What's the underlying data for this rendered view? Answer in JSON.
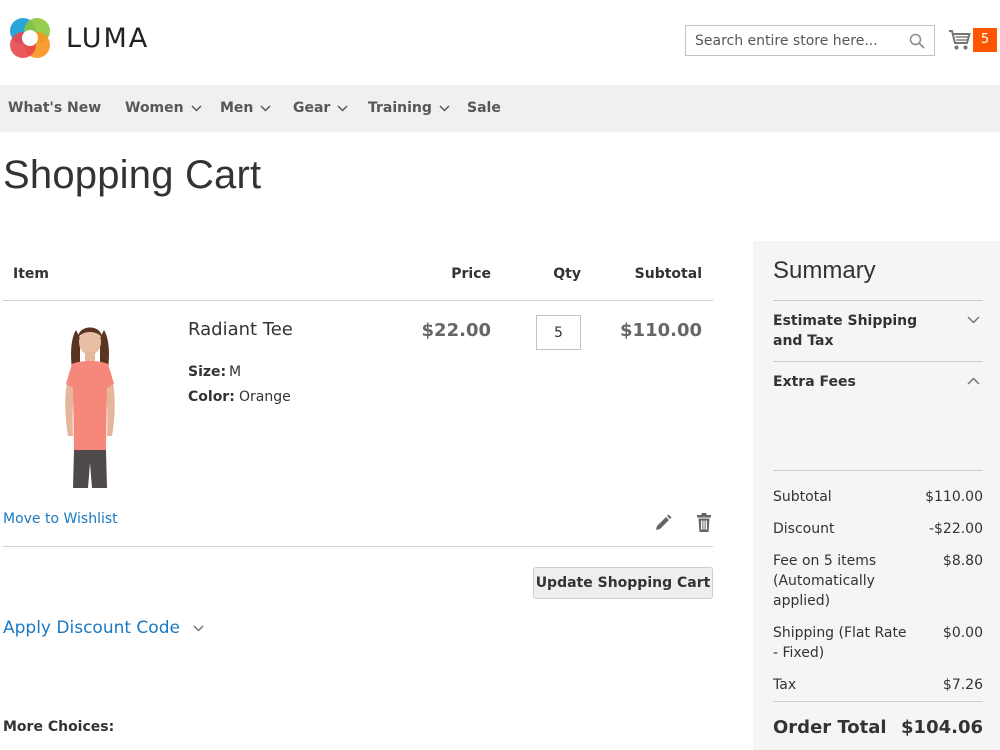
{
  "header": {
    "logo_text": "LUMA",
    "search_placeholder": "Search entire store here...",
    "cart_count": "5",
    "accent_color": "#ff5501"
  },
  "nav": {
    "items": [
      {
        "label": "What's New",
        "has_dropdown": false
      },
      {
        "label": "Women",
        "has_dropdown": true
      },
      {
        "label": "Men",
        "has_dropdown": true
      },
      {
        "label": "Gear",
        "has_dropdown": true
      },
      {
        "label": "Training",
        "has_dropdown": true
      },
      {
        "label": "Sale",
        "has_dropdown": false
      }
    ]
  },
  "page": {
    "title": "Shopping Cart"
  },
  "cart": {
    "columns": {
      "item": "Item",
      "price": "Price",
      "qty": "Qty",
      "subtotal": "Subtotal"
    },
    "items": [
      {
        "name": "Radiant Tee",
        "options": [
          {
            "label": "Size:",
            "value": "M"
          },
          {
            "label": "Color:",
            "value": "Orange"
          }
        ],
        "price": "$22.00",
        "qty": "5",
        "subtotal": "$110.00",
        "wishlist_label": "Move to Wishlist",
        "edit_icon": "pencil-icon",
        "remove_icon": "trash-icon"
      }
    ],
    "update_label": "Update Shopping Cart",
    "discount_label": "Apply Discount Code",
    "more_choices": "More Choices:"
  },
  "summary": {
    "title": "Summary",
    "estimate_shipping": "Estimate Shipping and Tax",
    "extra_fees": "Extra Fees",
    "rows": [
      {
        "label": "Subtotal",
        "value": "$110.00"
      },
      {
        "label": "Discount",
        "value": "-$22.00"
      },
      {
        "label": "Fee on 5 items (Automatically applied)",
        "value": "$8.80"
      },
      {
        "label": "Shipping (Flat Rate - Fixed)",
        "value": "$0.00"
      },
      {
        "label": "Tax",
        "value": "$7.26"
      }
    ],
    "order_total_label": "Order Total",
    "order_total_value": "$104.06"
  }
}
